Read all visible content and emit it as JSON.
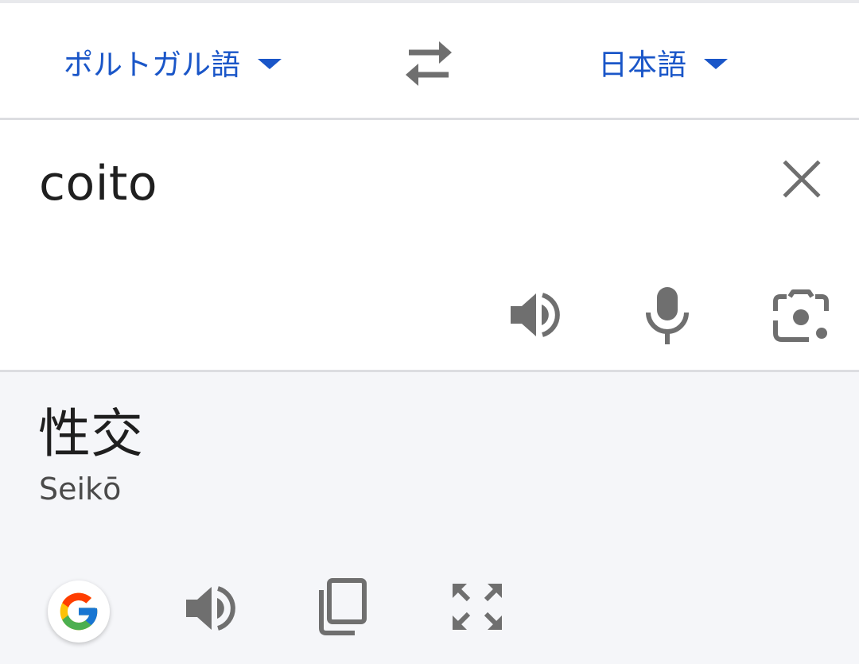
{
  "languages": {
    "source_label": "ポルトガル語",
    "target_label": "日本語"
  },
  "input": {
    "source_text": "coito"
  },
  "output": {
    "translated_text": "性交",
    "romanization": "Seikō"
  },
  "icons": {
    "swap": "swap-icon",
    "clear": "close-icon",
    "listen_source": "speaker-icon",
    "voice_input": "microphone-icon",
    "camera": "lens-camera-icon",
    "google": "google-logo-icon",
    "listen_translation": "speaker-icon",
    "copy": "copy-icon",
    "fullscreen": "fullscreen-icon"
  },
  "colors": {
    "accent": "#1a56c8",
    "icon_gray": "#6f6f6f",
    "text": "#1f1f1f",
    "output_background": "#f5f6f9"
  }
}
